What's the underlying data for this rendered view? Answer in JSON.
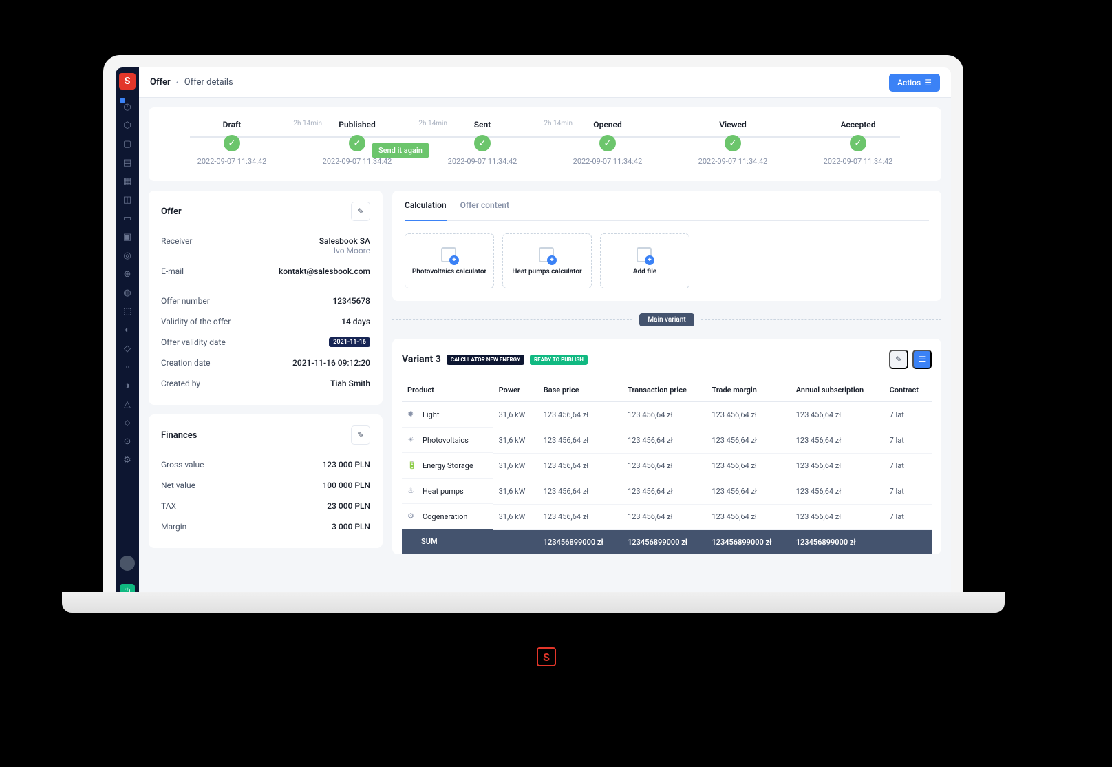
{
  "breadcrumb": {
    "root": "Offer",
    "page": "Offer details"
  },
  "actions_label": "Actios",
  "timeline": {
    "duration": "2h 14min",
    "send_again": "Send it again",
    "steps": [
      {
        "label": "Draft",
        "date": "2022-09-07 11:34:42"
      },
      {
        "label": "Published",
        "date": "2022-09-07 11:34:42"
      },
      {
        "label": "Sent",
        "date": "2022-09-07 11:34:42"
      },
      {
        "label": "Opened",
        "date": "2022-09-07 11:34:42"
      },
      {
        "label": "Viewed",
        "date": "2022-09-07 11:34:42"
      },
      {
        "label": "Accepted",
        "date": "2022-09-07 11:34:42"
      }
    ]
  },
  "offer": {
    "title": "Offer",
    "receiver_label": "Receiver",
    "receiver": "Salesbook SA",
    "receiver_person": "Ivo Moore",
    "email_label": "E-mail",
    "email": "kontakt@salesbook.com",
    "number_label": "Offer number",
    "number": "12345678",
    "validity_label": "Validity of the offer",
    "validity": "14 days",
    "validity_date_label": "Offer validity date",
    "validity_date": "2021-11-16",
    "creation_label": "Creation date",
    "creation": "2021-11-16 09:12:20",
    "created_by_label": "Created by",
    "created_by": "Tiah Smith"
  },
  "finances": {
    "title": "Finances",
    "gross_label": "Gross value",
    "gross": "123 000 PLN",
    "net_label": "Net value",
    "net": "100 000 PLN",
    "tax_label": "TAX",
    "tax": "23 000 PLN",
    "margin_label": "Margin",
    "margin": "3 000 PLN"
  },
  "tabs": {
    "calculation": "Calculation",
    "offer_content": "Offer content"
  },
  "tiles": {
    "pv": "Photovoltaics calculator",
    "hp": "Heat pumps calculator",
    "file": "Add file"
  },
  "main_variant": "Main variant",
  "variant": {
    "title": "Variant 3",
    "badge1": "CALCULATOR NEW ENERGY",
    "badge2": "READY TO PUBLISH",
    "headers": {
      "product": "Product",
      "power": "Power",
      "base": "Base price",
      "transaction": "Transaction price",
      "margin": "Trade margin",
      "annual": "Annual subscription",
      "contract": "Contract"
    },
    "rows": [
      {
        "name": "Light",
        "power": "31,6 kW",
        "base": "123 456,64 zł",
        "trans": "123 456,64 zł",
        "margin": "123 456,64 zł",
        "annual": "123 456,64 zł",
        "contract": "7 lat"
      },
      {
        "name": "Photovoltaics",
        "power": "31,6 kW",
        "base": "123 456,64 zł",
        "trans": "123 456,64 zł",
        "margin": "123 456,64 zł",
        "annual": "123 456,64 zł",
        "contract": "7 lat"
      },
      {
        "name": "Energy Storage",
        "power": "31,6 kW",
        "base": "123 456,64 zł",
        "trans": "123 456,64 zł",
        "margin": "123 456,64 zł",
        "annual": "123 456,64 zł",
        "contract": "7 lat"
      },
      {
        "name": "Heat pumps",
        "power": "31,6 kW",
        "base": "123 456,64 zł",
        "trans": "123 456,64 zł",
        "margin": "123 456,64 zł",
        "annual": "123 456,64 zł",
        "contract": "7 lat"
      },
      {
        "name": "Cogeneration",
        "power": "31,6 kW",
        "base": "123 456,64 zł",
        "trans": "123 456,64 zł",
        "margin": "123 456,64 zł",
        "annual": "123 456,64 zł",
        "contract": "7 lat"
      }
    ],
    "sum": {
      "label": "SUM",
      "base": "123456899000 zł",
      "trans": "123456899000 zł",
      "margin": "123456899000 zł",
      "annual": "123456899000 zł"
    }
  },
  "sidebar_icons": [
    "◷",
    "⬡",
    "▢",
    "▤",
    "▦",
    "◫",
    "▭",
    "▣",
    "◎",
    "⊕",
    "◍",
    "⬚",
    "◐",
    "◇",
    "▫",
    "◑",
    "△",
    "⬦",
    "⊙",
    "⚙"
  ]
}
